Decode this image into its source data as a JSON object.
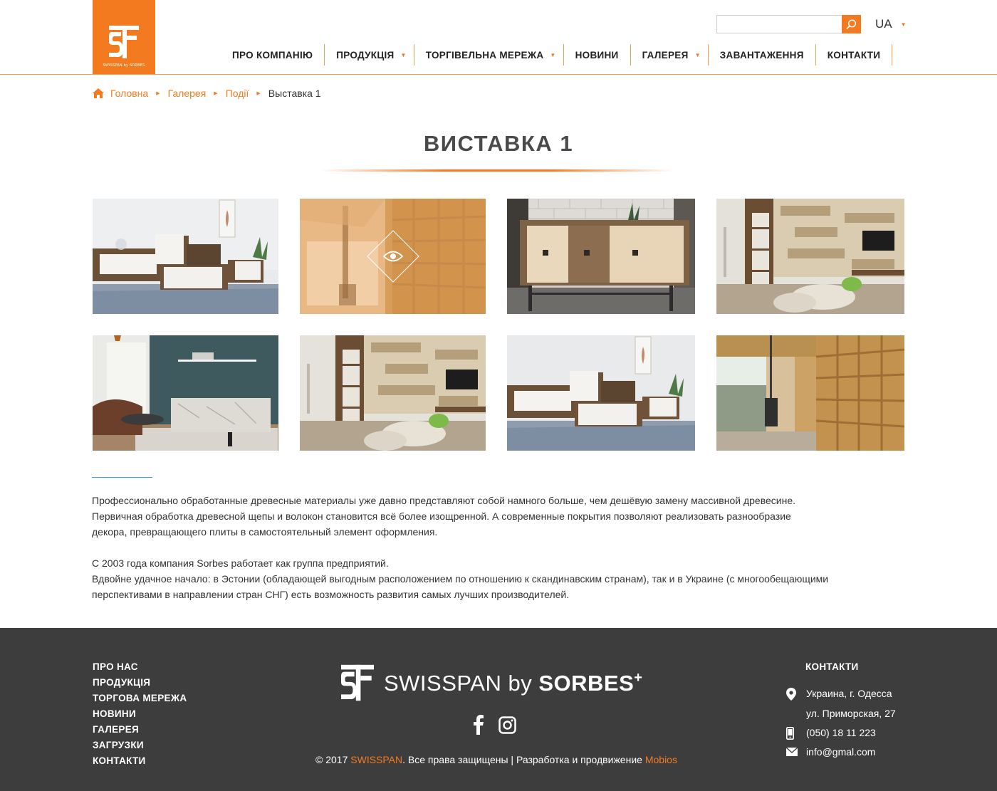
{
  "header": {
    "logo_caption": "SWISSPAN by SORBES",
    "search": {
      "value": "",
      "placeholder": ""
    },
    "language": "UA",
    "nav": [
      {
        "label": "ПРО КОМПАНІЮ",
        "dropdown": false
      },
      {
        "label": "ПРОДУКЦІЯ",
        "dropdown": true
      },
      {
        "label": "ТОРГІВЕЛЬНА МЕРЕЖА",
        "dropdown": true
      },
      {
        "label": "НОВИНИ",
        "dropdown": false
      },
      {
        "label": "ГАЛЕРЕЯ",
        "dropdown": true
      },
      {
        "label": "ЗАВАНТАЖЕННЯ",
        "dropdown": false
      },
      {
        "label": "КОНТАКТИ",
        "dropdown": false
      }
    ]
  },
  "breadcrumb": {
    "items": [
      "Головна",
      "Галерея",
      "Події"
    ],
    "current": "Выставка 1"
  },
  "page": {
    "title": "ВИСТАВКА 1",
    "description": [
      "Профессионально обработанные древесные материалы уже давно представляют собой намного больше, чем дешёвую замену массивной древесине.",
      "Первичная обработка древесной щепы и волокон становится всё более изощренной. А современные покрытия позволяют реализовать разнообразие",
      "декора, превращающего плиты в самостоятельный элемент оформления.",
      "",
      "С 2003 года компания Sorbes работает как группа предприятий.",
      "Вдвойне удачное начало: в Эстонии (обладающей выгодным расположением по отношению к скандинавским странам), так и в Украине (с многообещающими",
      "перспективами в направлении стран СНГ) есть возможность развития самых лучших производителей."
    ]
  },
  "gallery": {
    "images": [
      {
        "subject": "living room sideboard with white doors",
        "hovered": false
      },
      {
        "subject": "wooden shelving room",
        "hovered": true
      },
      {
        "subject": "sideboard against brick wall",
        "hovered": false
      },
      {
        "subject": "wood panel wall with tv",
        "hovered": false
      },
      {
        "subject": "teal living room with marble cabinet",
        "hovered": false
      },
      {
        "subject": "wood panel wall with tv",
        "hovered": false
      },
      {
        "subject": "living room sideboard with white doors",
        "hovered": false
      },
      {
        "subject": "osb shelving room with stove",
        "hovered": false
      }
    ],
    "overlay_color": "#f0a05a"
  },
  "footer": {
    "menu": [
      "ПРО НАС",
      "ПРОДУКЦІЯ",
      "ТОРГОВА МЕРЕЖА",
      "НОВИНИ",
      "ГАЛЕРЕЯ",
      "ЗАГРУЗКИ",
      "КОНТАКТИ"
    ],
    "logo": {
      "brand": "SWISSPAN",
      "by": "by",
      "partner": "SORBES",
      "plus": "+"
    },
    "social": [
      "facebook-icon",
      "instagram-icon"
    ],
    "copyright": {
      "prefix": "© 2017 ",
      "brand": "SWISSPAN",
      "middle": ". Все права защищены | Разработка и продвижение ",
      "dev": "Mobios"
    },
    "contacts": {
      "title": "КОНТАКТИ",
      "address_line1": "Украина, г. Одесса",
      "address_line2": "ул. Приморская, 27",
      "phone": "(050) 18 11 223",
      "email": "info@gmal.com"
    }
  },
  "colors": {
    "accent": "#f47a20",
    "footer_bg": "#3d3d3d",
    "link_blue": "#3da0d8"
  }
}
